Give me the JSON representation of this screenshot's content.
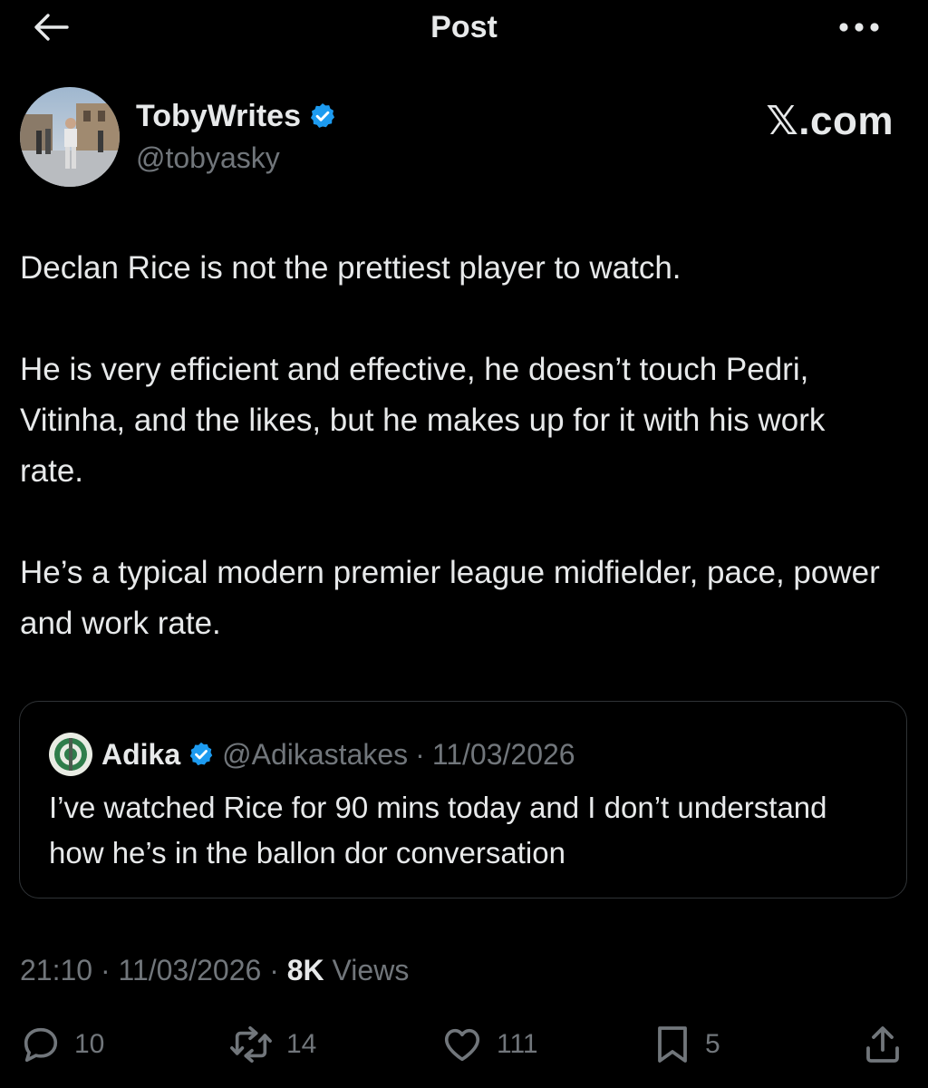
{
  "header": {
    "title": "Post"
  },
  "author": {
    "name": "TobyWrites",
    "handle": "@tobyasky",
    "verified": true
  },
  "brand": "𝕏.com",
  "post": {
    "paragraphs": [
      "Declan Rice is not the prettiest player to watch.",
      "He is very efficient and effective, he doesn’t touch Pedri, Vitinha, and the likes, but he makes up for it with his work rate.",
      "He’s a typical modern premier league midfielder, pace, power and work rate."
    ]
  },
  "quote": {
    "name": "Adika",
    "handle": "@Adikastakes",
    "separator": "·",
    "date": "11/03/2026",
    "verified": true,
    "text": "I’ve watched Rice for 90 mins today and I don’t understand how he’s in the ballon dor conversation"
  },
  "meta": {
    "time": "21:10",
    "separator": "·",
    "date": "11/03/2026",
    "views_count": "8K",
    "views_label": "Views"
  },
  "actions": {
    "replies": "10",
    "reposts": "14",
    "likes": "111",
    "bookmarks": "5"
  },
  "colors": {
    "background": "#000000",
    "text": "#e7e9ea",
    "secondary": "#71767b",
    "verified": "#1d9bf0",
    "border": "#2f3336"
  },
  "icons": [
    "arrow-left-icon",
    "more-horizontal-icon",
    "verified-badge-icon",
    "reply-icon",
    "repost-icon",
    "like-icon",
    "bookmark-icon",
    "share-icon"
  ]
}
